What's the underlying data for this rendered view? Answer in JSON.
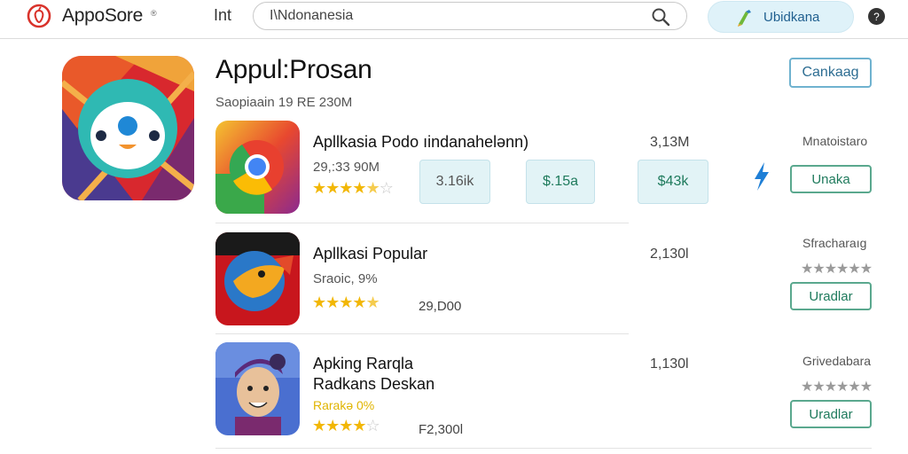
{
  "header": {
    "logo_text": "AppoSore",
    "logo_sup": "®",
    "nav_label": "Int",
    "search": {
      "value": "I\\Ndonanesia",
      "placeholder": ""
    },
    "update_label": "Ubidkana",
    "icons": {
      "logo": "apple-logo-icon",
      "search": "search-icon",
      "update": "update-icon",
      "help": "help-icon"
    }
  },
  "featured": {
    "title": "Appul:Prosan",
    "subtitle": "Saopiaain 19 RE 230M",
    "cancel_label": "Cankaag"
  },
  "apps": [
    {
      "name": "Apllkasia Podo ıindanahelənn)",
      "meta": "29,:33 90M",
      "rating": 4.5,
      "count": "3,13M",
      "seller": "Mnatoistaro",
      "chips": [
        "3.16ik",
        "$.15a",
        "$43k"
      ],
      "action_label": "Unaka"
    },
    {
      "name": "Apllkasi Popular",
      "meta": "Sraoic, 9%",
      "rating": 4.5,
      "inline_value": "29,D00",
      "count": "2,130l",
      "seller": "Sfracharaıg",
      "action_label": "Uradlar"
    },
    {
      "name": "Apking Rarqla",
      "name2": "Radkans Deskan",
      "promo": "Rarakə 0%",
      "rating": 4.5,
      "inline_value": "F2,300l",
      "count": "1,130l",
      "seller": "Grivedabara",
      "action_label": "Uradlar"
    }
  ],
  "colors": {
    "accent": "#6fb2cf",
    "action": "#5aa88e",
    "star": "#f2b705",
    "chip_bg": "#e2f3f6"
  }
}
